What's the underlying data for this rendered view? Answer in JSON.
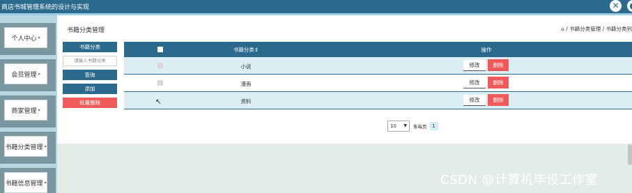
{
  "app": {
    "title": "商店书城管理系统的设计与实现"
  },
  "topbar": {
    "icon1": "expand-icon",
    "icon2": "user-icon"
  },
  "sidebar": {
    "items": [
      {
        "label": "个人中心"
      },
      {
        "label": "会员管理"
      },
      {
        "label": "商家管理"
      },
      {
        "label": "书籍分类管理"
      },
      {
        "label": "书籍信息管理"
      }
    ]
  },
  "page": {
    "title": "书籍分类管理",
    "breadcrumb": "/ 书籍分类管理 / 书籍分类列"
  },
  "leftpanel": {
    "header": "书籍分类",
    "search_placeholder": "请输入书籍分类",
    "query_label": "查询",
    "add_label": "添加",
    "batch_delete_label": "批量删除"
  },
  "table": {
    "header_name": "书籍分类",
    "header_op": "操作",
    "rows": [
      {
        "name": "小说"
      },
      {
        "name": "漫画"
      },
      {
        "name": "资料"
      }
    ],
    "edit_label": "修改",
    "delete_label": "删除"
  },
  "pager": {
    "page_size": "10",
    "per_page_label": "条每页",
    "current_page": "1"
  },
  "watermark": "CSDN @计算机毕设工作室",
  "colors": {
    "primary": "#2b6a8c",
    "danger": "#f05a5a",
    "row_alt": "#dbeef4"
  }
}
